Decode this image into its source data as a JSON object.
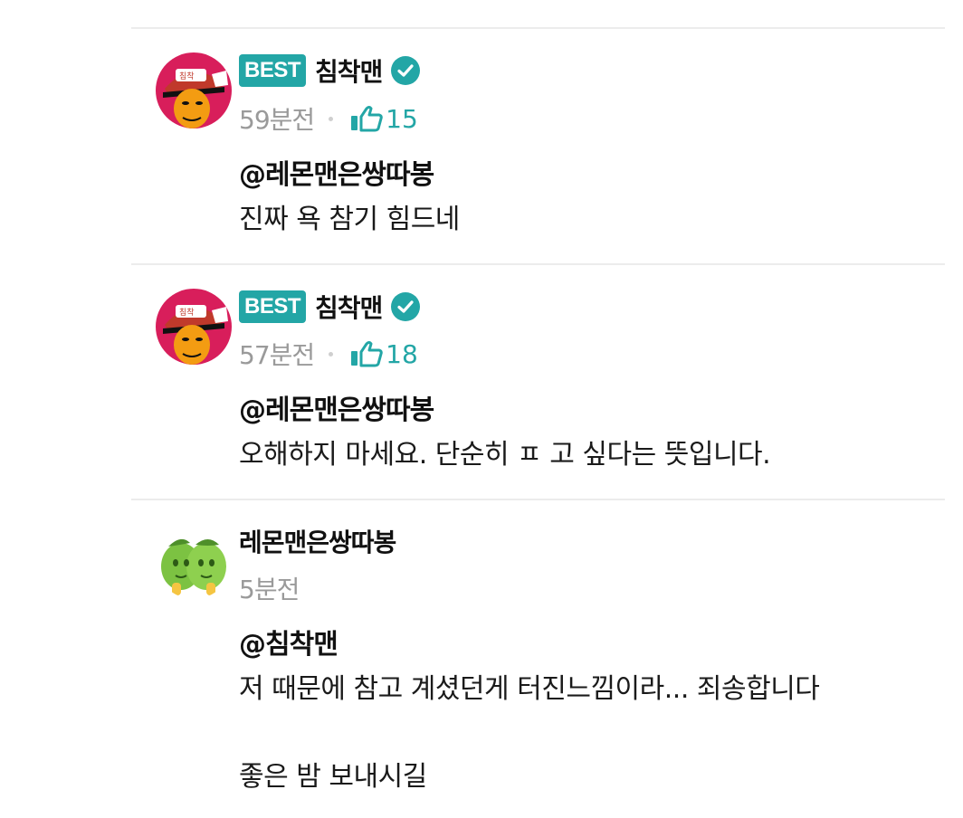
{
  "comments": [
    {
      "badge": "BEST",
      "author": "침착맨",
      "verified": true,
      "time": "59분전",
      "likes": "15",
      "mention": "@레몬맨은쌍따봉",
      "lines": [
        "진짜 욕 참기 힘드네"
      ]
    },
    {
      "badge": "BEST",
      "author": "침착맨",
      "verified": true,
      "time": "57분전",
      "likes": "18",
      "mention": "@레몬맨은쌍따봉",
      "lines": [
        "오해하지 마세요. 단순히 ㅍ 고 싶다는 뜻입니다."
      ]
    },
    {
      "author": "레몬맨은쌍따봉",
      "verified": false,
      "time": "5분전",
      "mention": "@침착맨",
      "lines": [
        "저 때문에 참고 계셨던게 터진느낌이라... 죄송합니다",
        "좋은 밤 보내시길"
      ]
    }
  ],
  "colors": {
    "accent": "#23a6a6",
    "muted": "#9a9a9a",
    "divider": "#ececec"
  },
  "icons": {
    "verified": "check-circle-icon",
    "like": "thumbs-up-icon"
  }
}
